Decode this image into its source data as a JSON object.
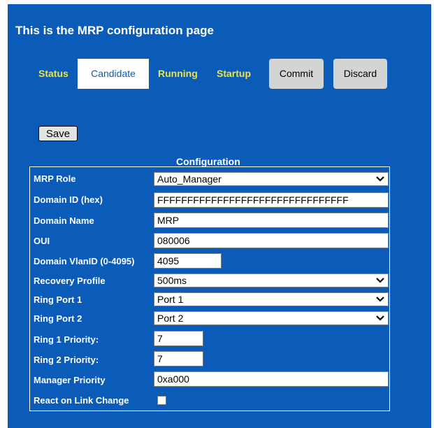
{
  "page": {
    "title": "This is the MRP configuration page"
  },
  "tabs": [
    "Status",
    "Candidate",
    "Running",
    "Startup"
  ],
  "actions": {
    "commit": "Commit",
    "discard": "Discard",
    "save": "Save"
  },
  "config": {
    "caption": "Configuration",
    "mrp_role": {
      "label": "MRP Role",
      "value": "Auto_Manager"
    },
    "domain_id": {
      "label": "Domain ID (hex)",
      "value": "FFFFFFFFFFFFFFFFFFFFFFFFFFFFFFFF"
    },
    "domain_name": {
      "label": "Domain Name",
      "value": "MRP"
    },
    "oui": {
      "label": "OUI",
      "value": "080006"
    },
    "domain_vlan": {
      "label": "Domain VlanID (0-4095)",
      "value": "4095"
    },
    "recovery_profile": {
      "label": "Recovery Profile",
      "value": "500ms"
    },
    "ring_port_1": {
      "label": "Ring Port 1",
      "value": "Port 1"
    },
    "ring_port_2": {
      "label": "Ring Port 2",
      "value": "Port 2"
    },
    "ring_1_priority": {
      "label": "Ring 1 Priority:",
      "value": "7"
    },
    "ring_2_priority": {
      "label": "Ring 2 Priority:",
      "value": "7"
    },
    "manager_priority": {
      "label": "Manager Priority",
      "value": "0xa000"
    },
    "react_on_link_change": {
      "label": "React on Link Change",
      "checked": false
    }
  },
  "colors": {
    "panel": "#0b5cb8",
    "tab_text": "#f2e33a",
    "button_gray": "#d4d4d4"
  }
}
